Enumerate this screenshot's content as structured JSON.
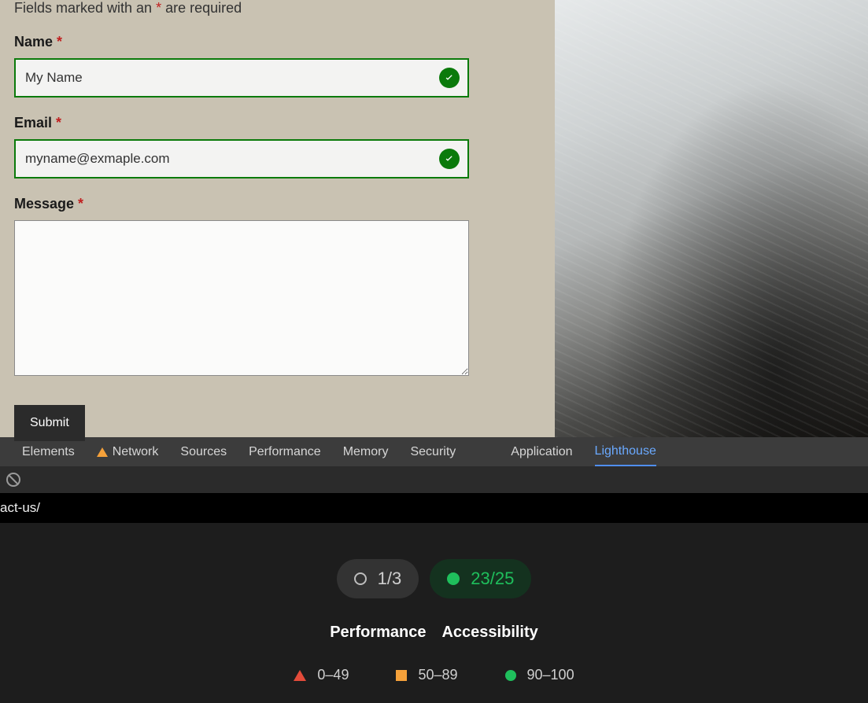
{
  "form": {
    "required_note_pre": "Fields marked with an ",
    "required_note_ast": "*",
    "required_note_post": " are required",
    "name_label": "Name ",
    "name_value": "My Name",
    "email_label": "Email ",
    "email_value": "myname@exmaple.com",
    "message_label": "Message ",
    "asterisk": "*",
    "submit_label": "Submit"
  },
  "devtools": {
    "tabs": {
      "elements": "Elements",
      "network": "Network",
      "sources": "Sources",
      "performance": "Performance",
      "memory": "Memory",
      "security": "Security",
      "application": "Application",
      "lighthouse": "Lighthouse"
    },
    "url_fragment": "act-us/"
  },
  "lighthouse": {
    "pill_gray": "1/3",
    "pill_green": "23/25",
    "categories": {
      "performance": "Performance",
      "accessibility": "Accessibility"
    },
    "legend": {
      "low": "0–49",
      "mid": "50–89",
      "high": "90–100"
    }
  }
}
